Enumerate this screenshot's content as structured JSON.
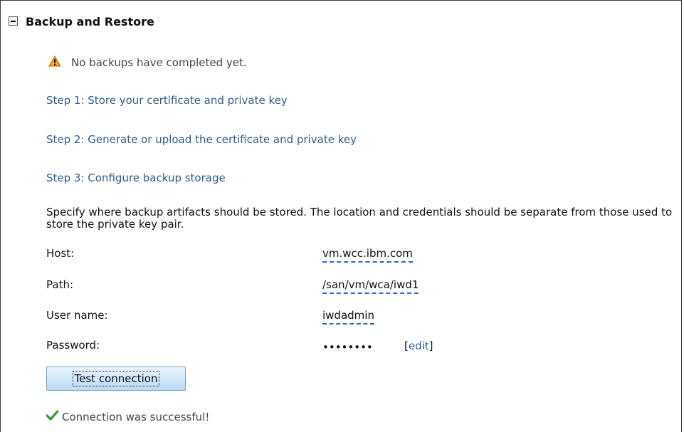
{
  "section": {
    "title": "Backup and Restore"
  },
  "status": {
    "warning_text": "No backups have completed yet.",
    "success_text": "Connection was successful!"
  },
  "steps": [
    {
      "label": "Step 1: Store your certificate and private key"
    },
    {
      "label": "Step 2: Generate or upload the certificate and private key"
    },
    {
      "label": "Step 3: Configure backup storage"
    }
  ],
  "storage": {
    "description": "Specify where backup artifacts should be stored. The location and credentials should be separate from those used to store the private key pair.",
    "fields": {
      "host": {
        "label": "Host:",
        "value": "vm.wcc.ibm.com"
      },
      "path": {
        "label": "Path:",
        "value": "/san/vm/wca/iwd1"
      },
      "username": {
        "label": "User name:",
        "value": "iwdadmin"
      },
      "password": {
        "label": "Password:",
        "value": "••••••••",
        "edit_label": "edit"
      }
    },
    "test_button_label": "Test connection"
  },
  "icons": {
    "collapse": "collapse-minus-icon",
    "warning": "warning-triangle-icon",
    "success": "green-check-icon"
  },
  "colors": {
    "link": "#2c5d94",
    "warning": "#f0a818",
    "success": "#2e9e2e",
    "button": "#b9dbf5"
  }
}
